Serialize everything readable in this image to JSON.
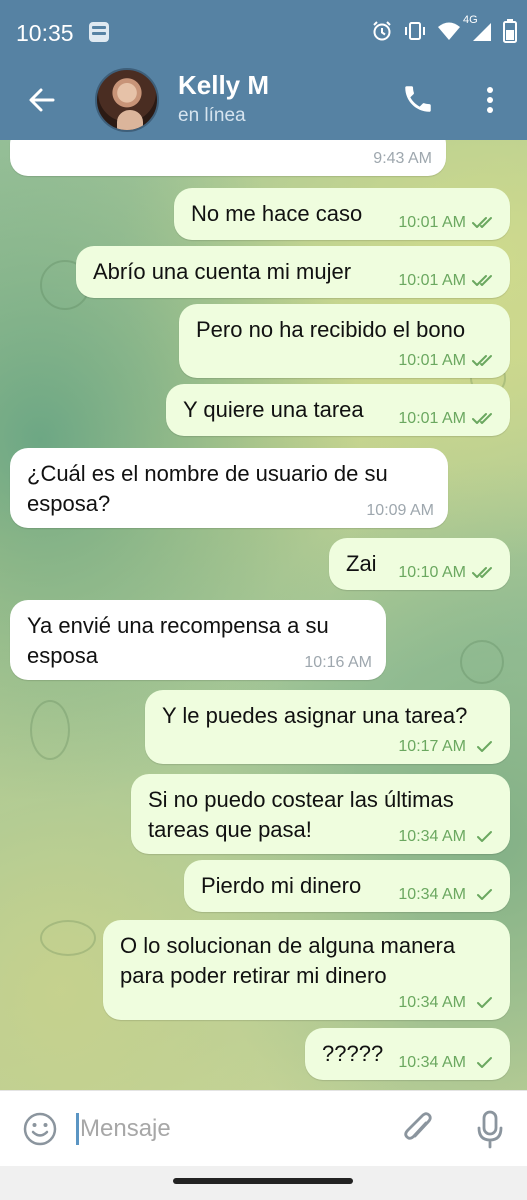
{
  "status_bar": {
    "time": "10:35",
    "network": "4G",
    "icons": [
      "app-notification-icon",
      "alarm-icon",
      "vibrate-icon",
      "wifi-icon",
      "cellular-signal-icon",
      "battery-icon"
    ]
  },
  "header": {
    "contact_name": "Kelly M",
    "contact_status": "en línea",
    "color": "#5682a3"
  },
  "messages": [
    {
      "dir": "in",
      "lines": [],
      "time": "9:43 AM",
      "read": false
    },
    {
      "dir": "out",
      "lines": [
        "No me hace caso"
      ],
      "time": "10:01 AM",
      "read": true
    },
    {
      "dir": "out",
      "lines": [
        "Abrío una cuenta mi mujer"
      ],
      "time": "10:01 AM",
      "read": true
    },
    {
      "dir": "out",
      "lines": [
        "Pero no ha recibido el bono"
      ],
      "time": "10:01 AM",
      "read": true
    },
    {
      "dir": "out",
      "lines": [
        "Y quiere una tarea"
      ],
      "time": "10:01 AM",
      "read": true
    },
    {
      "dir": "in",
      "lines": [
        "¿Cuál es el nombre de usuario de su",
        "esposa?"
      ],
      "time": "10:09 AM",
      "read": false
    },
    {
      "dir": "out",
      "lines": [
        "Zai"
      ],
      "time": "10:10 AM",
      "read": true
    },
    {
      "dir": "in",
      "lines": [
        "Ya envié una recompensa a su",
        "esposa"
      ],
      "time": "10:16 AM",
      "read": false
    },
    {
      "dir": "out",
      "lines": [
        "Y le puedes asignar una tarea?"
      ],
      "time": "10:17 AM",
      "read": false
    },
    {
      "dir": "out",
      "lines": [
        "Si no puedo costear las últimas",
        "tareas que pasa!"
      ],
      "time": "10:34 AM",
      "read": false
    },
    {
      "dir": "out",
      "lines": [
        "Pierdo mi dinero"
      ],
      "time": "10:34 AM",
      "read": false
    },
    {
      "dir": "out",
      "lines": [
        "O lo solucionan de alguna manera",
        "para poder retirar mi dinero"
      ],
      "time": "10:34 AM",
      "read": false
    },
    {
      "dir": "out",
      "lines": [
        "?????"
      ],
      "time": "10:34 AM",
      "read": false
    }
  ],
  "input": {
    "placeholder": "Mensaje",
    "value": ""
  },
  "colors": {
    "incoming_bubble": "#ffffff",
    "outgoing_bubble": "#effdde",
    "check_green": "#6ba860"
  }
}
